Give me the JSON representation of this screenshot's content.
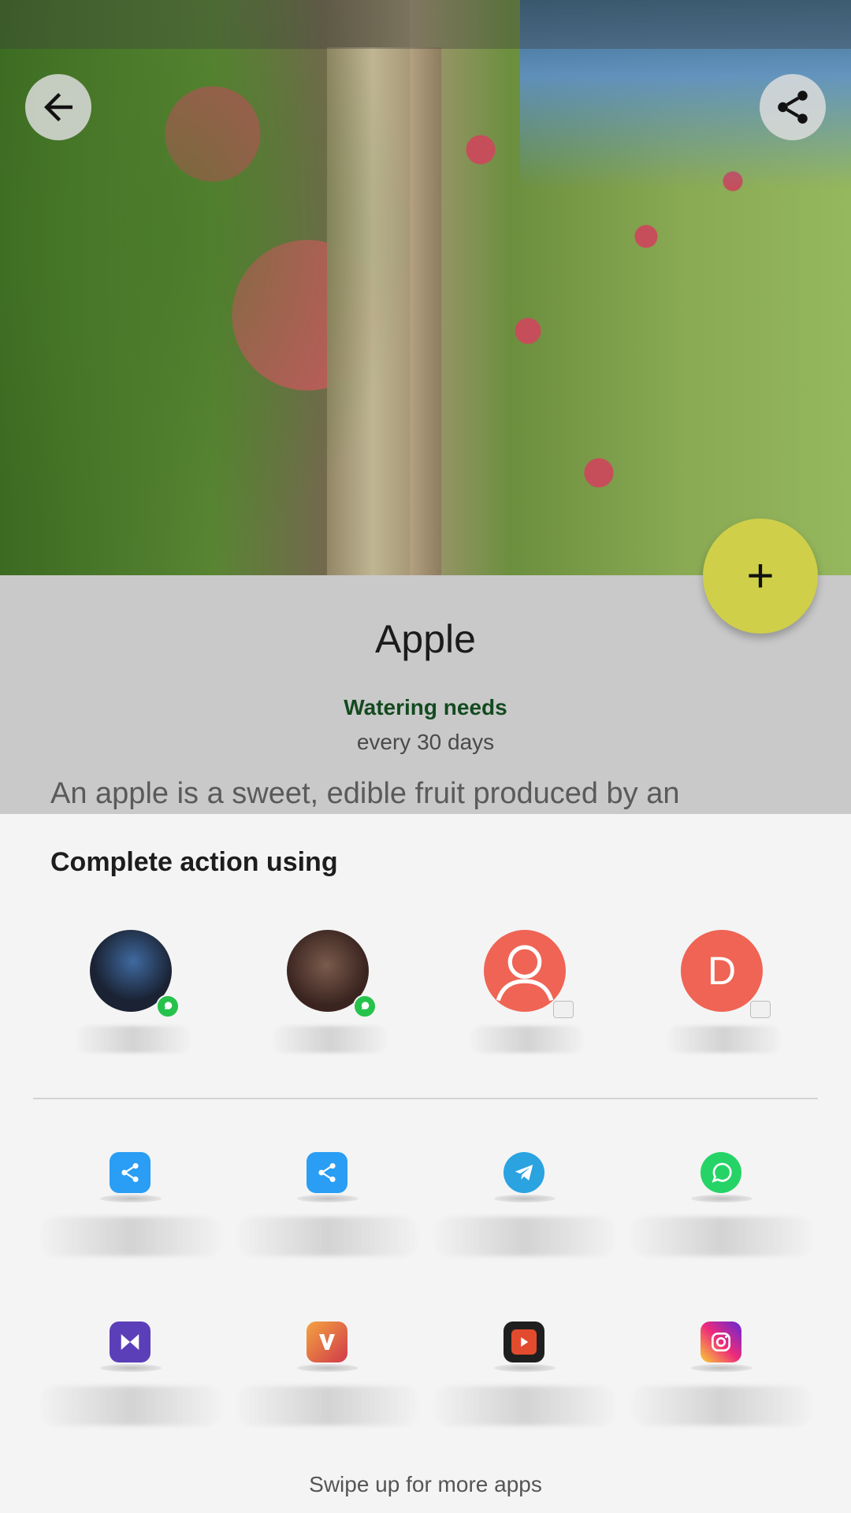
{
  "hero": {
    "image_alt": "Apple tree with ripe apples"
  },
  "plant": {
    "name": "Apple",
    "watering_title": "Watering needs",
    "watering_value": "every 30 days",
    "description": "An apple is a sweet, edible fruit produced by an"
  },
  "fab": {
    "symbol": "+"
  },
  "sheet": {
    "title": "Complete action using",
    "contacts": [
      {
        "icon": "whatsapp-badge"
      },
      {
        "icon": "whatsapp-badge"
      },
      {
        "icon": "message-badge"
      },
      {
        "letter": "D",
        "icon": "message-badge"
      }
    ],
    "apps": [
      {
        "icon": "share-it-icon",
        "color": "#2a9df4"
      },
      {
        "icon": "share-it-icon",
        "color": "#2a9df4"
      },
      {
        "icon": "telegram-icon",
        "color": "#2aa3e0"
      },
      {
        "icon": "whatsapp-icon",
        "color": "#25d366"
      },
      {
        "icon": "kinemaster-icon",
        "color": "#5b3fb8"
      },
      {
        "icon": "vidmate-icon",
        "color": "#e35a3a"
      },
      {
        "icon": "video-player-icon",
        "color": "#d8332a"
      },
      {
        "icon": "instagram-icon",
        "color": "#d6249f"
      }
    ],
    "footer": "Swipe up for more apps"
  }
}
